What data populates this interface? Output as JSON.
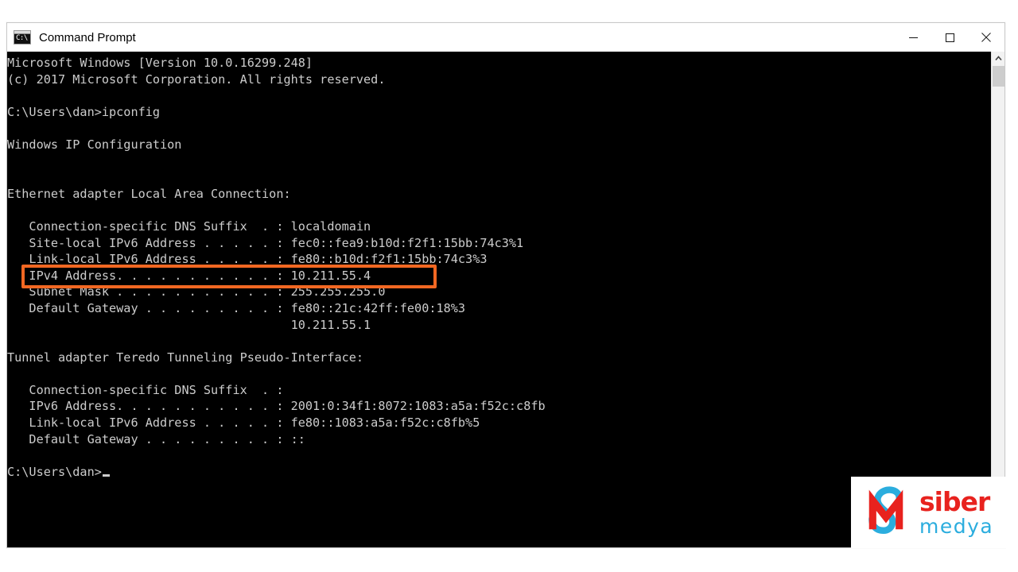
{
  "window": {
    "title": "Command Prompt",
    "icon": "command-prompt-icon",
    "icon_glyph": "C:\\",
    "buttons": {
      "minimize": "minimize-button",
      "maximize": "maximize-button",
      "close": "close-button"
    }
  },
  "console": {
    "background_color": "#000000",
    "text_color": "#cccccc",
    "lines": [
      "Microsoft Windows [Version 10.0.16299.248]",
      "(c) 2017 Microsoft Corporation. All rights reserved.",
      "",
      "C:\\Users\\dan>ipconfig",
      "",
      "Windows IP Configuration",
      "",
      "",
      "Ethernet adapter Local Area Connection:",
      "",
      "   Connection-specific DNS Suffix  . : localdomain",
      "   Site-local IPv6 Address . . . . . : fec0::fea9:b10d:f2f1:15bb:74c3%1",
      "   Link-local IPv6 Address . . . . . : fe80::b10d:f2f1:15bb:74c3%3",
      "   IPv4 Address. . . . . . . . . . . : 10.211.55.4",
      "   Subnet Mask . . . . . . . . . . . : 255.255.255.0",
      "   Default Gateway . . . . . . . . . : fe80::21c:42ff:fe00:18%3",
      "                                       10.211.55.1",
      "",
      "Tunnel adapter Teredo Tunneling Pseudo-Interface:",
      "",
      "   Connection-specific DNS Suffix  . :",
      "   IPv6 Address. . . . . . . . . . . : 2001:0:34f1:8072:1083:a5a:f52c:c8fb",
      "   Link-local IPv6 Address . . . . . : fe80::1083:a5a:f52c:c8fb%5",
      "   Default Gateway . . . . . . . . . : ::",
      "",
      "C:\\Users\\dan>"
    ],
    "prompt_line_index": 25,
    "cursor_visible": true
  },
  "annotation": {
    "highlight_color": "#f26722",
    "highlighted_line": "   IPv4 Address. . . . . . . . . . . : 10.211.55.4",
    "highlighted_value": "10.211.55.4"
  },
  "scrollbar": {
    "up_arrow": "chevron-up-icon",
    "down_arrow": "chevron-down-icon",
    "thumb": "scrollbar-thumb"
  },
  "watermark": {
    "brand_primary": "siber",
    "brand_secondary": "medya",
    "primary_color": "#e8221e",
    "secondary_color": "#2badde",
    "mark": "sibermedya-logo-mark"
  }
}
